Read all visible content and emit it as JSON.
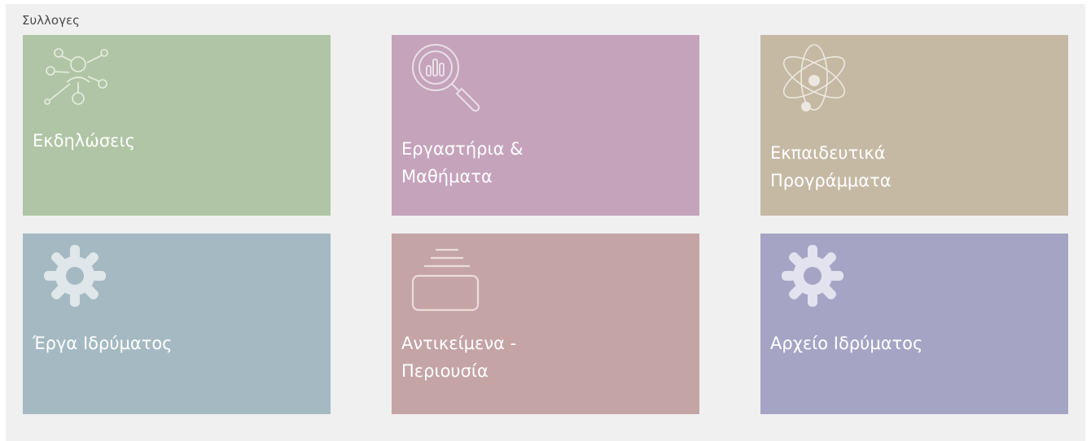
{
  "section": {
    "title": "Συλλογες"
  },
  "tiles": [
    {
      "label": "Εκδηλώσεις",
      "color": "#b0c5a5",
      "icon": "network-people-icon"
    },
    {
      "label": "Εργαστήρια &\nΜαθήματα",
      "color": "#c4a3bb",
      "icon": "magnifier-chart-icon"
    },
    {
      "label": "Εκπαιδευτικά\nΠρογράμματα",
      "color": "#c5b9a4",
      "icon": "atom-icon"
    },
    {
      "label": "Έργα Ιδρύματος",
      "color": "#a5b9c2",
      "icon": "gear-icon"
    },
    {
      "label": "Αντικείμενα -\nΠεριουσία",
      "color": "#c4a4a5",
      "icon": "stacked-box-icon"
    },
    {
      "label": "Αρχείο Ιδρύματος",
      "color": "#a5a4c4",
      "icon": "gear-icon"
    }
  ]
}
